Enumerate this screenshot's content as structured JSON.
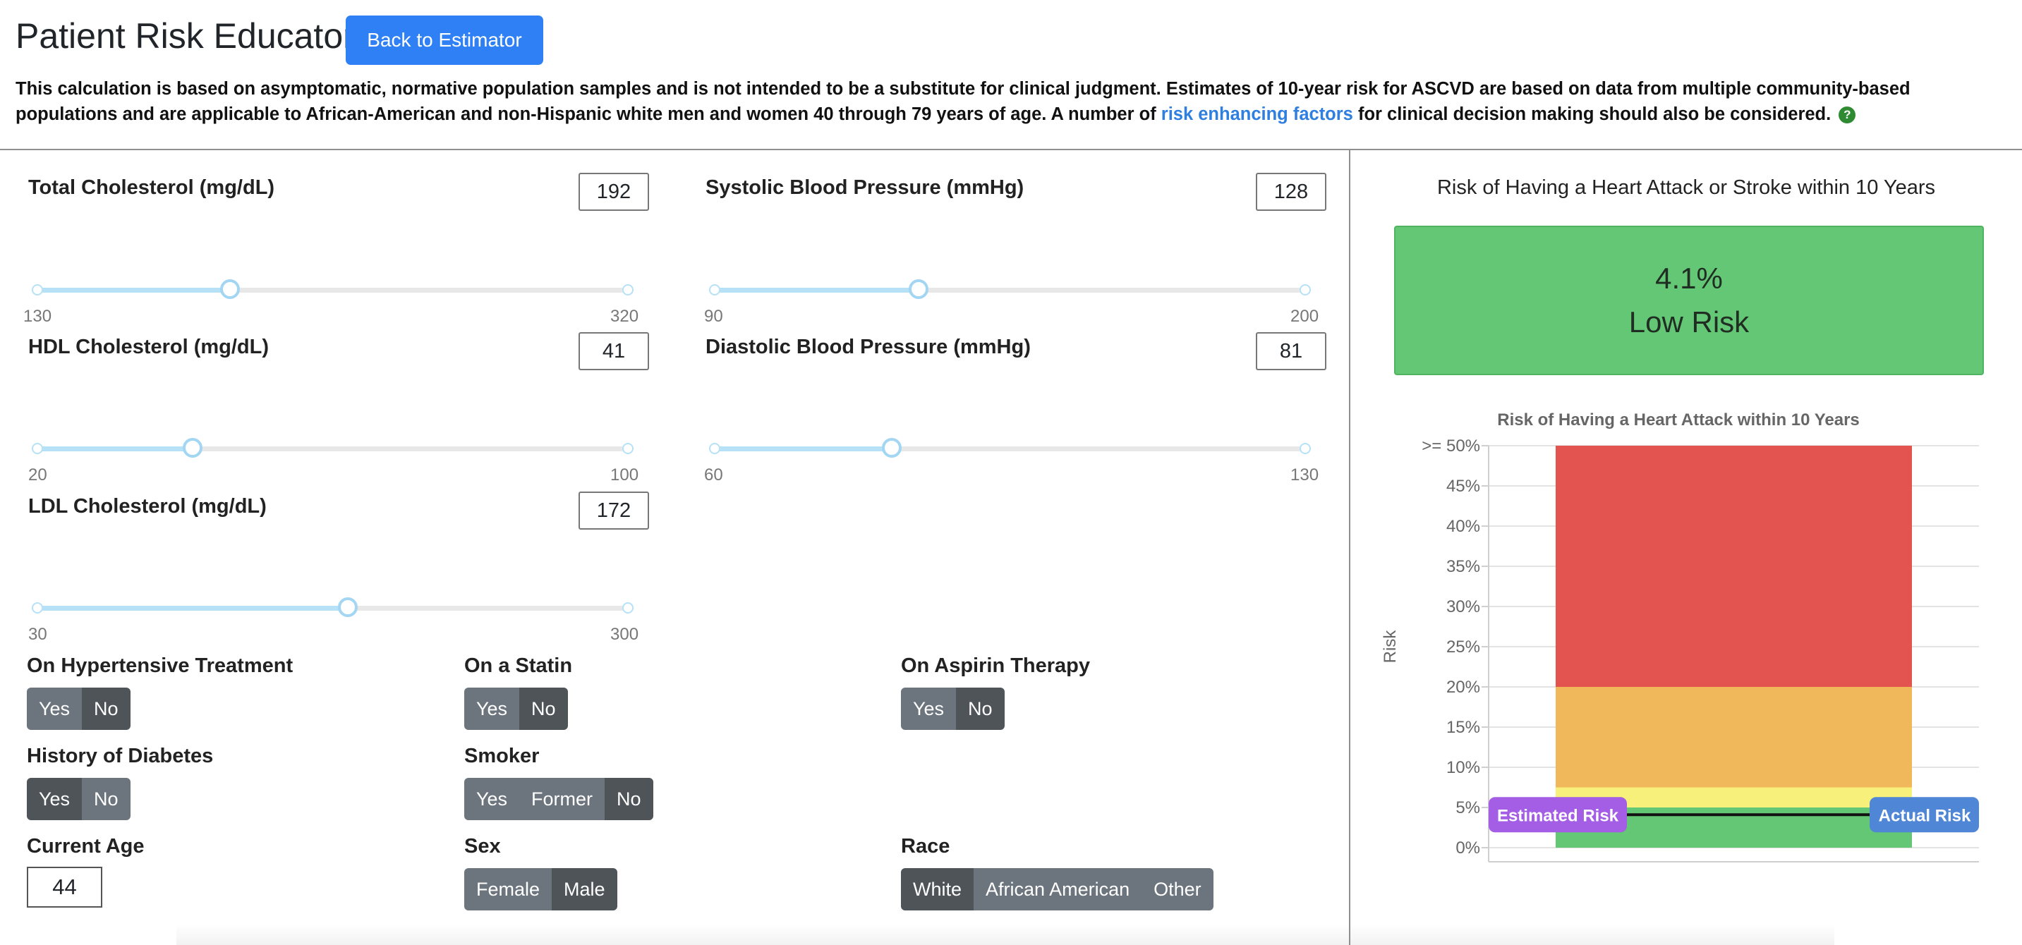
{
  "header": {
    "title": "Patient Risk Educator",
    "back_button": "Back to Estimator",
    "disclaimer_part1": "This calculation is based on asymptomatic, normative population samples and is not intended to be a substitute for clinical judgment. Estimates of 10-year risk for ASCVD are based on data from multiple community-based populations and are applicable to African-American and non-Hispanic white men and women 40 through 79 years of age. A number of",
    "disclaimer_link": "risk enhancing factors",
    "disclaimer_part2": "for clinical decision making should also be considered.",
    "help_icon": "question-circle-icon"
  },
  "sliders": {
    "total_cholesterol": {
      "label": "Total Cholesterol (mg/dL)",
      "value": 192,
      "min": 130,
      "max": 320
    },
    "systolic_bp": {
      "label": "Systolic Blood Pressure (mmHg)",
      "value": 128,
      "min": 90,
      "max": 200
    },
    "hdl": {
      "label": "HDL Cholesterol (mg/dL)",
      "value": 41,
      "min": 20,
      "max": 100
    },
    "diastolic_bp": {
      "label": "Diastolic Blood Pressure (mmHg)",
      "value": 81,
      "min": 60,
      "max": 130
    },
    "ldl": {
      "label": "LDL Cholesterol (mg/dL)",
      "value": 172,
      "min": 30,
      "max": 300
    }
  },
  "toggles": {
    "hypertensive": {
      "label": "On Hypertensive Treatment",
      "options": [
        "Yes",
        "No"
      ],
      "selected": "No"
    },
    "statin": {
      "label": "On a Statin",
      "options": [
        "Yes",
        "No"
      ],
      "selected": "No"
    },
    "aspirin": {
      "label": "On Aspirin Therapy",
      "options": [
        "Yes",
        "No"
      ],
      "selected": "No"
    },
    "diabetes": {
      "label": "History of Diabetes",
      "options": [
        "Yes",
        "No"
      ],
      "selected": "Yes"
    },
    "smoker": {
      "label": "Smoker",
      "options": [
        "Yes",
        "Former",
        "No"
      ],
      "selected": "No"
    },
    "sex": {
      "label": "Sex",
      "options": [
        "Female",
        "Male"
      ],
      "selected": "Male"
    },
    "race": {
      "label": "Race",
      "options": [
        "White",
        "African American",
        "Other"
      ],
      "selected": "White"
    }
  },
  "age": {
    "label": "Current Age",
    "value": "44"
  },
  "risk": {
    "title": "Risk of Having a Heart Attack or Stroke within 10 Years",
    "percent": "4.1%",
    "level": "Low Risk",
    "box_color": "#64c775"
  },
  "chart_data": {
    "type": "bar",
    "title": "Risk of Having a Heart Attack within 10 Years",
    "ylabel": "Risk",
    "ylim": [
      0,
      50
    ],
    "yticks": [
      "0%",
      "5%",
      "10%",
      "15%",
      "20%",
      "25%",
      "30%",
      "35%",
      "40%",
      "45%",
      ">= 50%"
    ],
    "bands": [
      {
        "from": 0,
        "to": 5,
        "color": "#64c775"
      },
      {
        "from": 5,
        "to": 7.5,
        "color": "#f7f07a"
      },
      {
        "from": 7.5,
        "to": 20,
        "color": "#f0b85a"
      },
      {
        "from": 20,
        "to": 50,
        "color": "#e3534f"
      }
    ],
    "estimated_risk": {
      "label": "Estimated Risk",
      "value": 4.1,
      "color": "#a45ee5"
    },
    "actual_risk": {
      "label": "Actual Risk",
      "value": 4.1,
      "color": "#4f86d6"
    },
    "grid": true
  }
}
